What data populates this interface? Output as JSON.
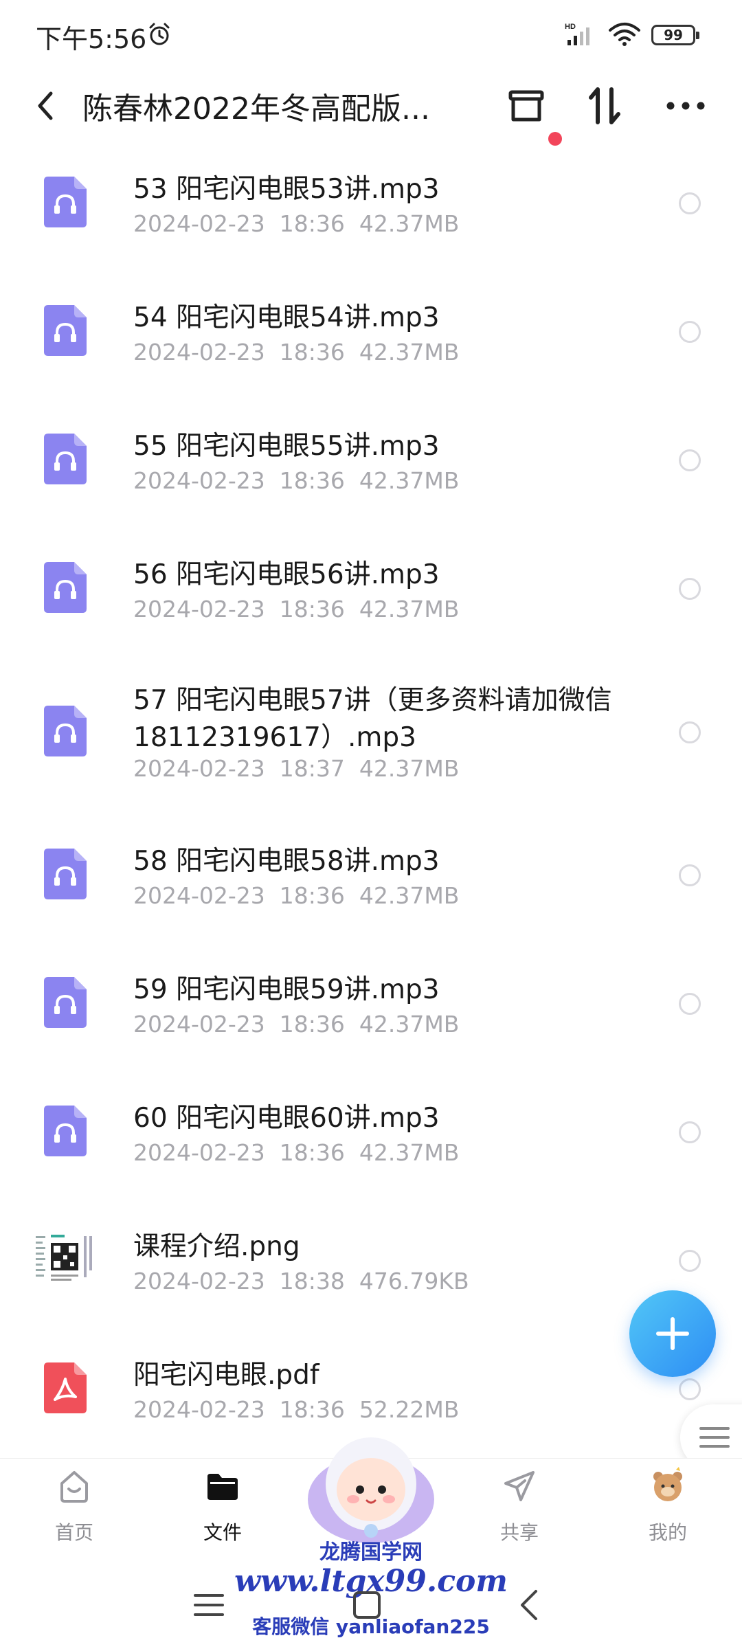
{
  "status_bar": {
    "time": "下午5:56",
    "battery": "99",
    "network": "HD"
  },
  "header": {
    "title": "陈春林2022年冬高配版..."
  },
  "files": [
    {
      "name": "53 阳宅闪电眼53讲.mp3",
      "date": "2024-02-23",
      "time": "18:36",
      "size": "42.37MB",
      "type": "audio"
    },
    {
      "name": "54 阳宅闪电眼54讲.mp3",
      "date": "2024-02-23",
      "time": "18:36",
      "size": "42.37MB",
      "type": "audio"
    },
    {
      "name": "55 阳宅闪电眼55讲.mp3",
      "date": "2024-02-23",
      "time": "18:36",
      "size": "42.37MB",
      "type": "audio"
    },
    {
      "name": "56 阳宅闪电眼56讲.mp3",
      "date": "2024-02-23",
      "time": "18:36",
      "size": "42.37MB",
      "type": "audio"
    },
    {
      "name_line1": "57  阳宅闪电眼57讲（更多资料请加微信",
      "name_line2": "18112319617）.mp3",
      "date": "2024-02-23",
      "time": "18:37",
      "size": "42.37MB",
      "type": "audio"
    },
    {
      "name": "58 阳宅闪电眼58讲.mp3",
      "date": "2024-02-23",
      "time": "18:36",
      "size": "42.37MB",
      "type": "audio"
    },
    {
      "name": "59 阳宅闪电眼59讲.mp3",
      "date": "2024-02-23",
      "time": "18:36",
      "size": "42.37MB",
      "type": "audio"
    },
    {
      "name": "60 阳宅闪电眼60讲.mp3",
      "date": "2024-02-23",
      "time": "18:36",
      "size": "42.37MB",
      "type": "audio"
    },
    {
      "name": "课程介绍.png",
      "date": "2024-02-23",
      "time": "18:38",
      "size": "476.79KB",
      "type": "image"
    },
    {
      "name": "阳宅闪电眼.pdf",
      "date": "2024-02-23",
      "time": "18:36",
      "size": "52.22MB",
      "type": "pdf"
    }
  ],
  "tabs": [
    {
      "label": "首页",
      "icon": "home-icon"
    },
    {
      "label": "文件",
      "icon": "folder-icon",
      "active": true
    },
    {
      "label": "共享",
      "icon": "share-icon"
    },
    {
      "label": "我的",
      "icon": "avatar-icon"
    }
  ],
  "watermark": {
    "name": "龙腾国学网",
    "url": "www.ltgx99.com",
    "contact": "客服微信 yanliaofan225"
  },
  "colors": {
    "accent": "#2d8df4",
    "audio_icon": "#8b84f0",
    "pdf_icon": "#f0505a",
    "badge": "#f2455a"
  }
}
